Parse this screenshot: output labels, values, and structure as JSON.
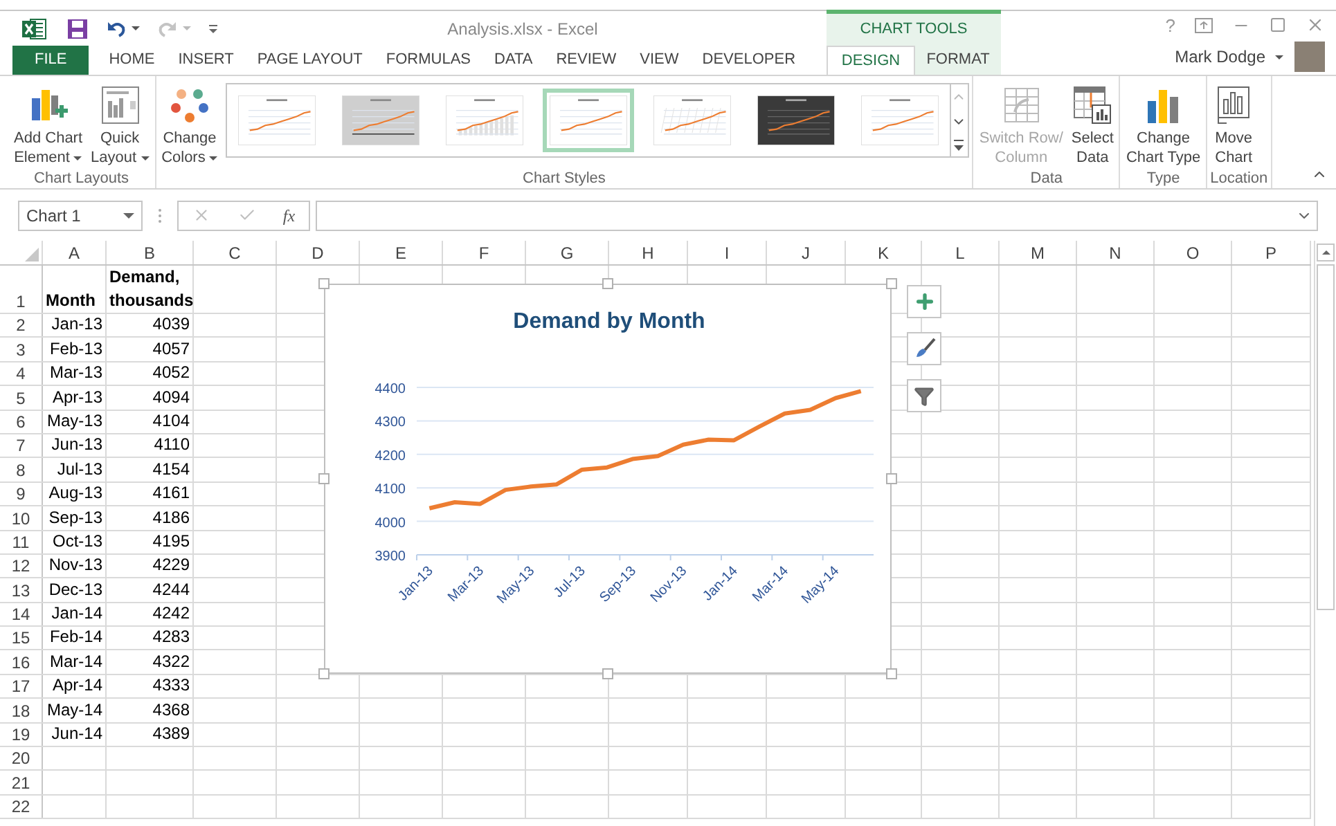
{
  "title_bar": {
    "title": "Analysis.xlsx - Excel",
    "quick_access": [
      {
        "kind": "save",
        "disabled": false,
        "dropdown": false
      },
      {
        "kind": "undo",
        "disabled": false,
        "dropdown": true
      },
      {
        "kind": "redo",
        "disabled": true,
        "dropdown": true
      },
      {
        "kind": "customize",
        "disabled": false,
        "dropdown": false
      }
    ],
    "help": "?",
    "user": "Mark Dodge"
  },
  "tabs": [
    {
      "label": "FILE",
      "kind": "file",
      "selected": false
    },
    {
      "label": "HOME",
      "kind": "normal",
      "selected": false
    },
    {
      "label": "INSERT",
      "kind": "normal",
      "selected": false
    },
    {
      "label": "PAGE LAYOUT",
      "kind": "normal",
      "selected": false
    },
    {
      "label": "FORMULAS",
      "kind": "normal",
      "selected": false
    },
    {
      "label": "DATA",
      "kind": "normal",
      "selected": false
    },
    {
      "label": "REVIEW",
      "kind": "normal",
      "selected": false
    },
    {
      "label": "VIEW",
      "kind": "normal",
      "selected": false
    },
    {
      "label": "DEVELOPER",
      "kind": "normal",
      "selected": false
    }
  ],
  "contextual_tabs": {
    "label": "CHART TOOLS",
    "tabs": [
      {
        "label": "DESIGN",
        "selected": true
      },
      {
        "label": "FORMAT",
        "selected": false
      }
    ]
  },
  "ribbon": {
    "groups": [
      {
        "label": "Chart Layouts",
        "buttons": [
          {
            "kind": "add_element",
            "lines": [
              "Add Chart",
              "Element"
            ],
            "dropdown": true,
            "disabled": false
          },
          {
            "kind": "quick_layout",
            "lines": [
              "Quick",
              "Layout"
            ],
            "dropdown": true,
            "disabled": false
          }
        ]
      },
      {
        "label": "Chart Styles",
        "buttons": [
          {
            "kind": "colors",
            "lines": [
              "Change",
              "Colors"
            ],
            "dropdown": true,
            "disabled": false
          }
        ],
        "gallery": [
          {
            "kind": "white",
            "selected": false
          },
          {
            "kind": "gray",
            "selected": false
          },
          {
            "kind": "columns",
            "selected": false
          },
          {
            "kind": "white",
            "selected": true
          },
          {
            "kind": "hatched",
            "selected": false
          },
          {
            "kind": "dark",
            "selected": false
          },
          {
            "kind": "white",
            "selected": false
          }
        ]
      },
      {
        "label": "Data",
        "buttons": [
          {
            "kind": "switch",
            "lines": [
              "Switch Row/",
              "Column"
            ],
            "dropdown": false,
            "disabled": true
          },
          {
            "kind": "select_data",
            "lines": [
              "Select",
              "Data"
            ],
            "dropdown": false,
            "disabled": false
          }
        ]
      },
      {
        "label": "Type",
        "buttons": [
          {
            "kind": "chart_type",
            "lines": [
              "Change",
              "Chart Type"
            ],
            "dropdown": false,
            "disabled": false
          }
        ]
      },
      {
        "label": "Location",
        "buttons": [
          {
            "kind": "move_chart",
            "lines": [
              "Move",
              "Chart"
            ],
            "dropdown": false,
            "disabled": false
          }
        ]
      }
    ]
  },
  "formula_bar": {
    "name_box": "Chart 1",
    "function_label": "fx"
  },
  "sheet": {
    "columns": [
      "A",
      "B",
      "C",
      "D",
      "E",
      "F",
      "G",
      "H",
      "I",
      "J",
      "K",
      "L",
      "M",
      "N",
      "O",
      "P"
    ],
    "rows": [
      {
        "number": "1",
        "kind": "header",
        "cells": [
          "Month",
          "Demand, thousands"
        ]
      },
      {
        "number": "2",
        "kind": "data",
        "cells": [
          "Jan-13",
          "4039"
        ]
      },
      {
        "number": "3",
        "kind": "data",
        "cells": [
          "Feb-13",
          "4057"
        ]
      },
      {
        "number": "4",
        "kind": "data",
        "cells": [
          "Mar-13",
          "4052"
        ]
      },
      {
        "number": "5",
        "kind": "data",
        "cells": [
          "Apr-13",
          "4094"
        ]
      },
      {
        "number": "6",
        "kind": "data",
        "cells": [
          "May-13",
          "4104"
        ]
      },
      {
        "number": "7",
        "kind": "data",
        "cells": [
          "Jun-13",
          "4110"
        ]
      },
      {
        "number": "8",
        "kind": "data",
        "cells": [
          "Jul-13",
          "4154"
        ]
      },
      {
        "number": "9",
        "kind": "data",
        "cells": [
          "Aug-13",
          "4161"
        ]
      },
      {
        "number": "10",
        "kind": "data",
        "cells": [
          "Sep-13",
          "4186"
        ]
      },
      {
        "number": "11",
        "kind": "data",
        "cells": [
          "Oct-13",
          "4195"
        ]
      },
      {
        "number": "12",
        "kind": "data",
        "cells": [
          "Nov-13",
          "4229"
        ]
      },
      {
        "number": "13",
        "kind": "data",
        "cells": [
          "Dec-13",
          "4244"
        ]
      },
      {
        "number": "14",
        "kind": "data",
        "cells": [
          "Jan-14",
          "4242"
        ]
      },
      {
        "number": "15",
        "kind": "data",
        "cells": [
          "Feb-14",
          "4283"
        ]
      },
      {
        "number": "16",
        "kind": "data",
        "cells": [
          "Mar-14",
          "4322"
        ]
      },
      {
        "number": "17",
        "kind": "data",
        "cells": [
          "Apr-14",
          "4333"
        ]
      },
      {
        "number": "18",
        "kind": "data",
        "cells": [
          "May-14",
          "4368"
        ]
      },
      {
        "number": "19",
        "kind": "data",
        "cells": [
          "Jun-14",
          "4389"
        ]
      },
      {
        "number": "20",
        "kind": "data",
        "cells": []
      },
      {
        "number": "21",
        "kind": "data",
        "cells": []
      },
      {
        "number": "22",
        "kind": "data",
        "cells": []
      }
    ]
  },
  "chart": {
    "chart_data": {
      "type": "line",
      "title": "Demand by Month",
      "categories": [
        "Jan-13",
        null,
        "Mar-13",
        null,
        "May-13",
        null,
        "Jul-13",
        null,
        "Sep-13",
        null,
        "Nov-13",
        null,
        "Jan-14",
        null,
        "Mar-14",
        null,
        "May-14",
        null
      ],
      "grid": true,
      "series": [
        {
          "color": "#ed7d31",
          "values": [
            4039,
            4057,
            4052,
            4094,
            4104,
            4110,
            4154,
            4161,
            4186,
            4195,
            4229,
            4244,
            4242,
            4283,
            4322,
            4333,
            4368,
            4389
          ]
        }
      ],
      "ylim": [
        3900,
        4400
      ],
      "yticks": [
        3900,
        4000,
        4100,
        4200,
        4300,
        4400
      ]
    }
  }
}
